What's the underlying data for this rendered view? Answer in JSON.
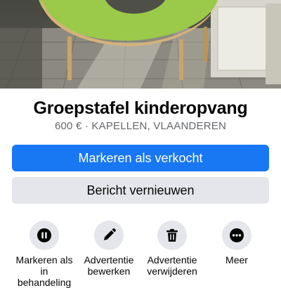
{
  "listing": {
    "title": "Groepstafel kinderopvang",
    "subtitle": "600 € · KAPELLEN, VLAANDEREN",
    "photo_description_icon": "listing-photo"
  },
  "buttons": {
    "mark_sold": "Markeren als verkocht",
    "renew": "Bericht vernieuwen"
  },
  "actions": [
    {
      "label": "Markeren als in behandeling",
      "icon": "pause-icon"
    },
    {
      "label": "Advertentie bewerken",
      "icon": "pencil-icon"
    },
    {
      "label": "Advertentie verwijderen",
      "icon": "trash-icon"
    },
    {
      "label": "Meer",
      "icon": "more-icon"
    }
  ],
  "colors": {
    "primary": "#1877f2",
    "secondary_bg": "#e4e6eb",
    "muted_text": "#65676b",
    "table_green": "#9bc94a"
  }
}
